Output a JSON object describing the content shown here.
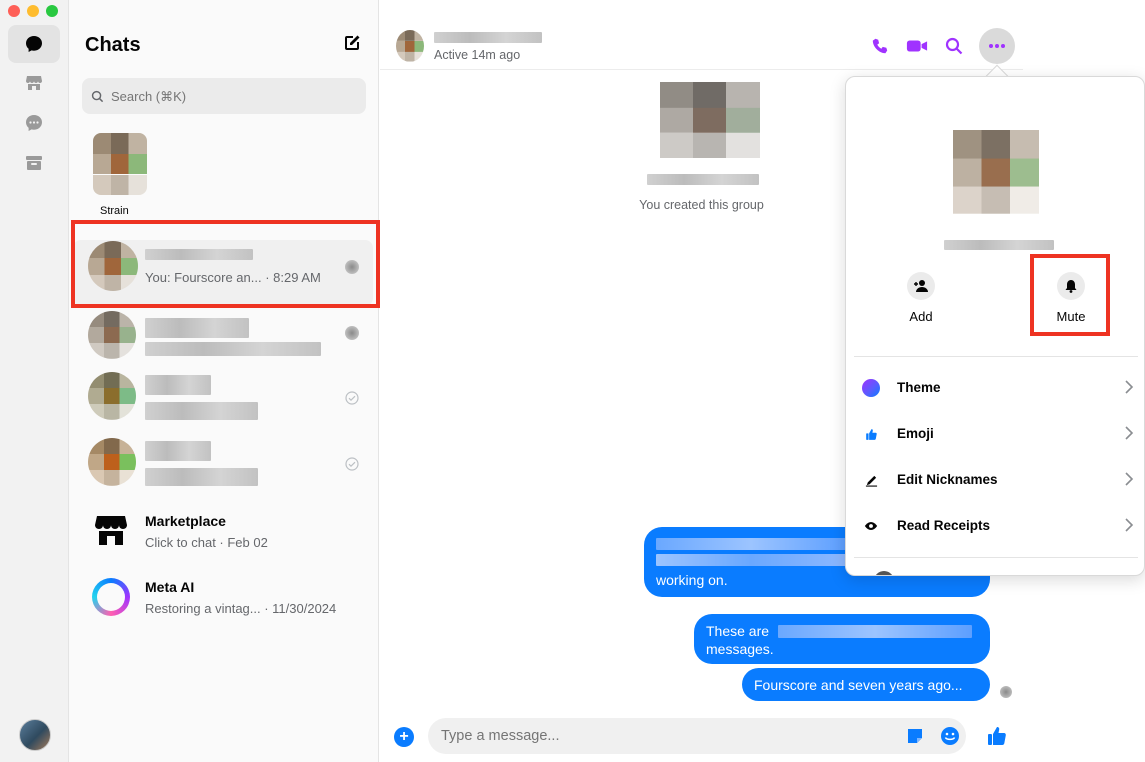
{
  "sidebar": {
    "title": "Chats",
    "search_placeholder": "Search (⌘K)",
    "chats": [
      {
        "name": "Strain",
        "subtitle": ""
      },
      {
        "name": "",
        "subtitle": "You: Fourscore an... · 8:29 AM"
      },
      {
        "name": "",
        "subtitle": ""
      },
      {
        "name": "",
        "subtitle": ""
      },
      {
        "name": "",
        "subtitle": ""
      },
      {
        "name": "Marketplace",
        "subtitle": "Click to chat · Feb 02"
      },
      {
        "name": "Meta AI",
        "subtitle": "Restoring a vintag... · 11/30/2024"
      }
    ]
  },
  "conversation": {
    "status": "Active 14m ago",
    "created_note": "You created this group",
    "messages": [
      {
        "text": "working on."
      },
      {
        "text": "These are",
        "text2": "messages."
      },
      {
        "text": "Fourscore and seven years ago..."
      }
    ],
    "composer_placeholder": "Type a message..."
  },
  "popover": {
    "actions": [
      {
        "label": "Add"
      },
      {
        "label": "Mute"
      }
    ],
    "items": [
      {
        "label": "Theme"
      },
      {
        "label": "Emoji"
      },
      {
        "label": "Edit Nicknames"
      },
      {
        "label": "Read Receipts"
      }
    ]
  },
  "colors": {
    "accent": "#0a7cff",
    "header_icons": "#a033ff",
    "highlight": "#ee3322"
  }
}
